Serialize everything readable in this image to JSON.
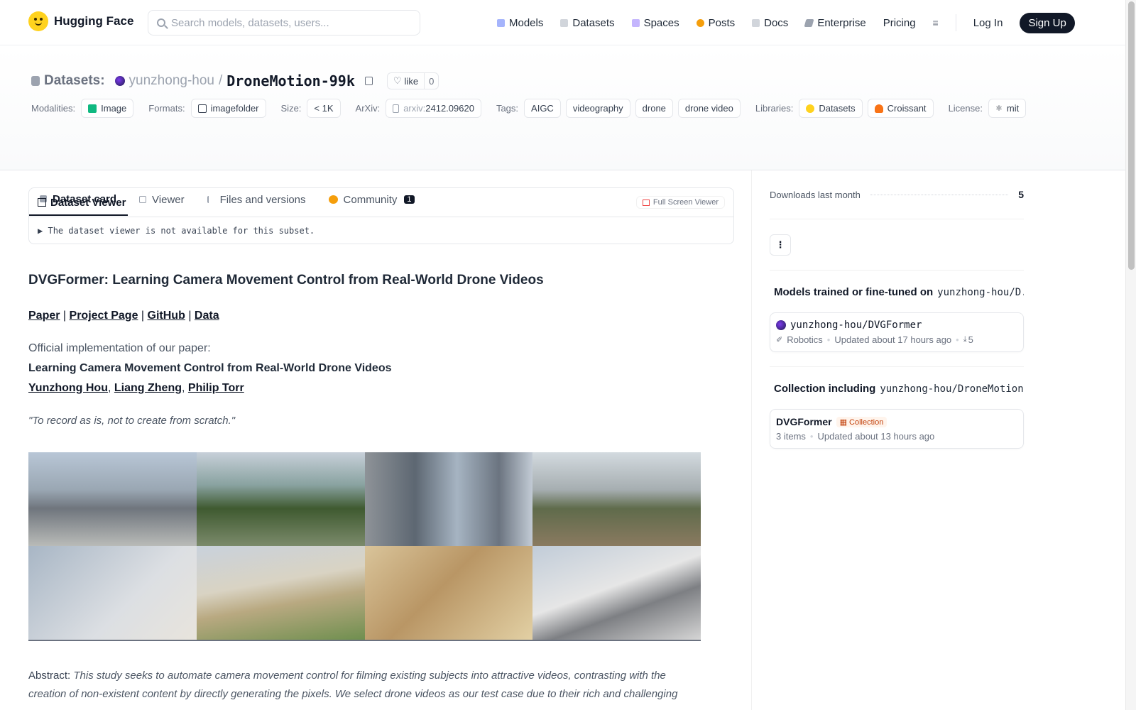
{
  "brand": {
    "name": "Hugging Face"
  },
  "search": {
    "placeholder": "Search models, datasets, users..."
  },
  "nav": {
    "models": "Models",
    "datasets": "Datasets",
    "spaces": "Spaces",
    "posts": "Posts",
    "docs": "Docs",
    "enterprise": "Enterprise",
    "pricing": "Pricing",
    "login": "Log In",
    "signup": "Sign Up"
  },
  "repo": {
    "prefix": "Datasets:",
    "user": "yunzhong-hou",
    "sep": "/",
    "name": "DroneMotion-99k",
    "like_label": "like",
    "like_count": "0"
  },
  "meta": {
    "modalities_label": "Modalities:",
    "modality": "Image",
    "formats_label": "Formats:",
    "format": "imagefolder",
    "size_label": "Size:",
    "size": "< 1K",
    "arxiv_label": "ArXiv:",
    "arxiv_prefix": "arxiv:",
    "arxiv_id": "2412.09620",
    "tags_label": "Tags:",
    "tags": [
      "AIGC",
      "videography",
      "drone",
      "drone video"
    ],
    "libraries_label": "Libraries:",
    "libraries": [
      "Datasets",
      "Croissant"
    ],
    "license_label": "License:",
    "license": "mit"
  },
  "tabs": {
    "card": "Dataset card",
    "viewer": "Viewer",
    "files": "Files and versions",
    "community": "Community",
    "community_count": "1"
  },
  "viewer": {
    "title": "Dataset Viewer",
    "fullscreen": "Full Screen Viewer",
    "notice": "The dataset viewer is not available for this subset."
  },
  "content": {
    "heading": "DVGFormer: Learning Camera Movement Control from Real-World Drone Videos",
    "links": [
      "Paper",
      "Project Page",
      "GitHub",
      "Data"
    ],
    "link_sep": "|",
    "official": "Official implementation of our paper:",
    "paper_title": "Learning Camera Movement Control from Real-World Drone Videos",
    "authors": [
      "Yunzhong Hou",
      "Liang Zheng",
      "Philip Torr"
    ],
    "author_sep": ",",
    "quote": "\"To record as is, not to create from scratch.\"",
    "abstract_label": "Abstract:",
    "abstract_text": "This study seeks to automate camera movement control for filming existing subjects into attractive videos, contrasting with the creation of non-existent content by directly generating the pixels. We select drone videos as our test case due to their rich and challenging"
  },
  "sidebar": {
    "downloads_label": "Downloads last month",
    "downloads_value": "5",
    "kebab": "⋮",
    "models_title": "Models trained or fine-tuned on",
    "models_ref": "yunzhong-hou/D...",
    "model_name": "yunzhong-hou/DVGFormer",
    "model_task": "Robotics",
    "model_updated": "Updated about 17 hours ago",
    "model_downloads": "5",
    "collection_title": "Collection including",
    "collection_ref": "yunzhong-hou/DroneMotion...",
    "collection_name": "DVGFormer",
    "collection_badge": "Collection",
    "collection_items": "3 items",
    "collection_updated": "Updated about 13 hours ago"
  }
}
